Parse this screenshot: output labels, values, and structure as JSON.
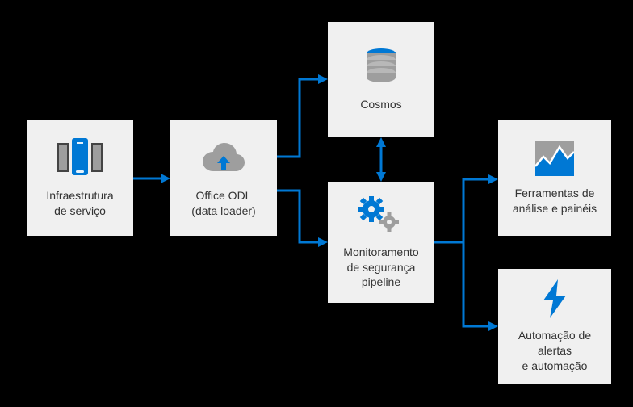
{
  "boxes": {
    "infra": {
      "label": "Infraestrutura\nde serviço"
    },
    "odl": {
      "label": "Office ODL\n(data loader)"
    },
    "cosmos": {
      "label": "Cosmos"
    },
    "monitor": {
      "label": "Monitoramento\nde segurança\npipeline"
    },
    "tools": {
      "label": "Ferramentas de\nanálise e painéis"
    },
    "auto": {
      "label": "Automação de alertas\ne automação"
    }
  },
  "colors": {
    "accent": "#0078d4",
    "box": "#f0f0f0",
    "icon_gray": "#9e9e9e"
  }
}
